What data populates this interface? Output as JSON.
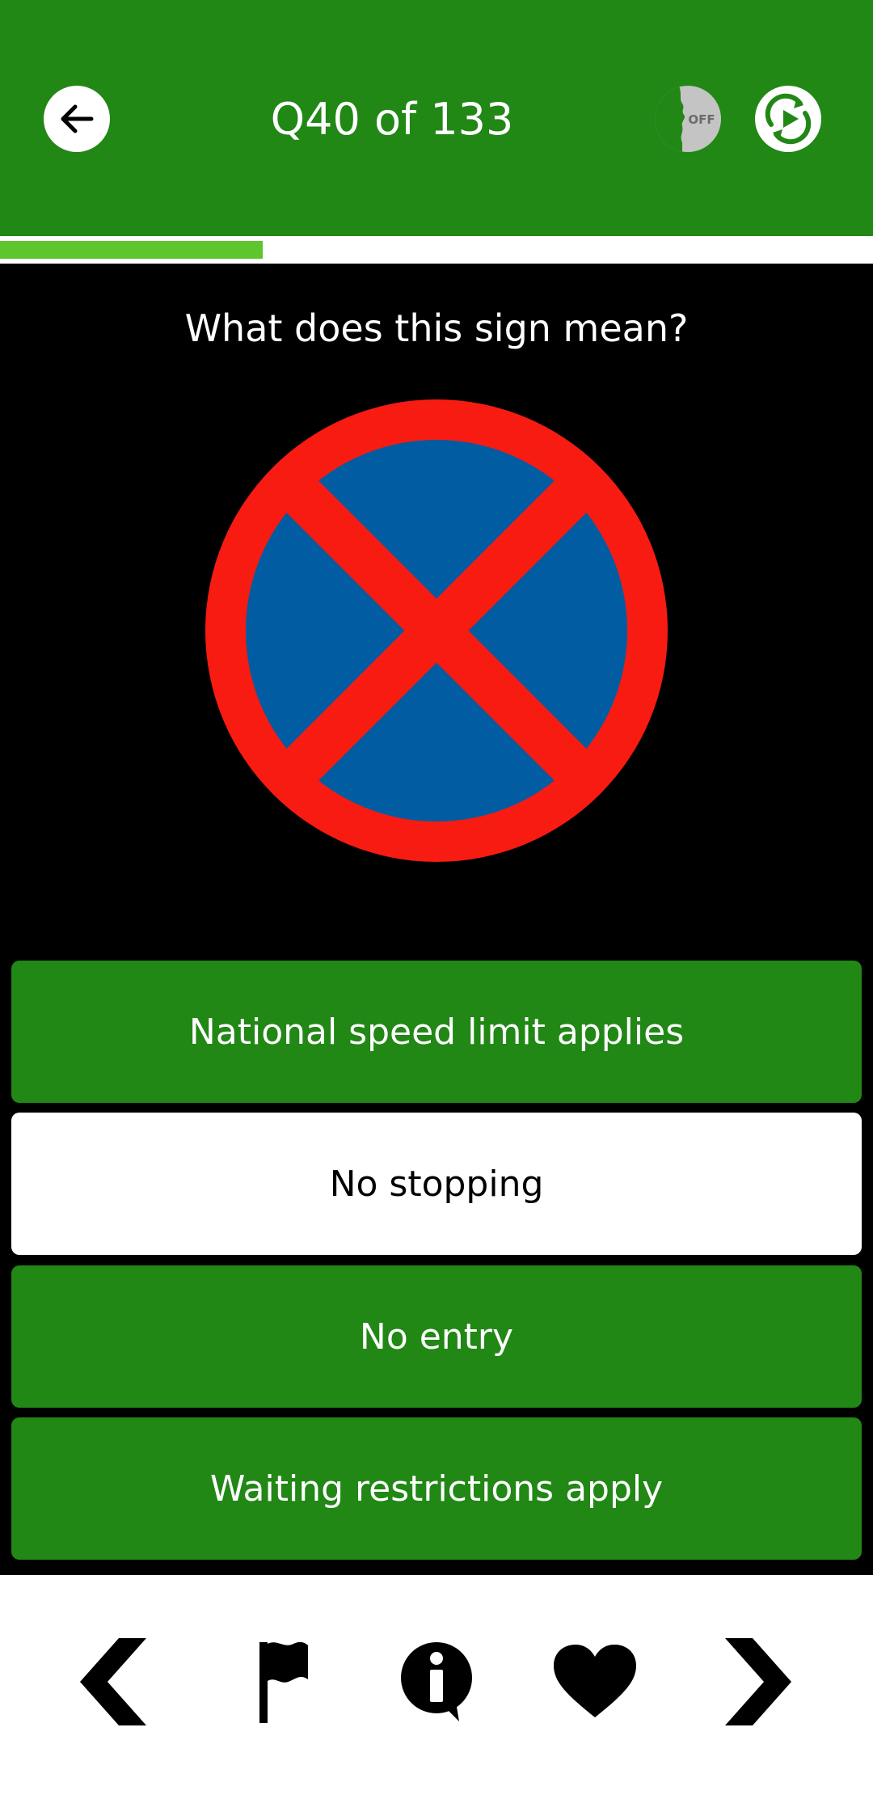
{
  "header": {
    "title": "Q40 of 133",
    "voice_toggle_label": "OFF",
    "background": "#218715"
  },
  "progress": {
    "current": 40,
    "total": 133,
    "fill_color": "#5fc52c"
  },
  "question": {
    "text": "What does this sign mean?",
    "sign_icon": "no-stopping-sign-icon"
  },
  "answers": [
    {
      "label": "National speed limit applies",
      "selected": false
    },
    {
      "label": "No stopping",
      "selected": true
    },
    {
      "label": "No entry",
      "selected": false
    },
    {
      "label": "Waiting restrictions apply",
      "selected": false
    }
  ],
  "bottom_nav": {
    "icons": [
      "chevron-left-icon",
      "flag-icon",
      "info-icon",
      "heart-icon",
      "chevron-right-icon"
    ]
  },
  "colors": {
    "accent_green": "#218715",
    "sign_red": "#f71b12",
    "sign_blue": "#025ca1"
  }
}
